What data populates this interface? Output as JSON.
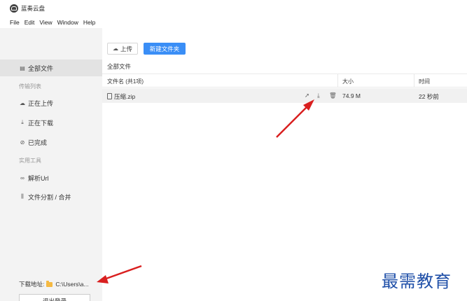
{
  "app": {
    "title": "蓝奏云盘"
  },
  "menu": [
    "File",
    "Edit",
    "View",
    "Window",
    "Help"
  ],
  "sidebar": {
    "items": [
      {
        "label": "全部文件",
        "icon": "folder-icon",
        "glyph": "▤"
      },
      {
        "label": "正在上传",
        "icon": "cloud-upload-icon",
        "glyph": "☁"
      },
      {
        "label": "正在下载",
        "icon": "download-icon",
        "glyph": "⤓"
      },
      {
        "label": "已完成",
        "icon": "check-circle-icon",
        "glyph": "⊘"
      },
      {
        "label": "解析Url",
        "icon": "link-icon",
        "glyph": "∞"
      },
      {
        "label": "文件分割 / 合并",
        "icon": "split-icon",
        "glyph": "⫼"
      }
    ],
    "section_transfer": "传输列表",
    "section_tools": "实用工具",
    "download_path_label": "下载地址:",
    "download_path_value": "C:\\Users\\a...",
    "logout_label": "退出登录"
  },
  "toolbar": {
    "upload_label": "上传",
    "new_folder_label": "新建文件夹"
  },
  "breadcrumb": "全部文件",
  "table": {
    "columns": [
      "文件名 (共1项)",
      "大小",
      "时间"
    ],
    "rows": [
      {
        "name": "压缩.zip",
        "size": "74.9 M",
        "time": "22 秒前"
      }
    ]
  },
  "watermark": "最需教育",
  "colors": {
    "accent": "#3a8ef6",
    "annotation_arrow": "#d91f1f",
    "watermark": "#1f4fa8"
  }
}
